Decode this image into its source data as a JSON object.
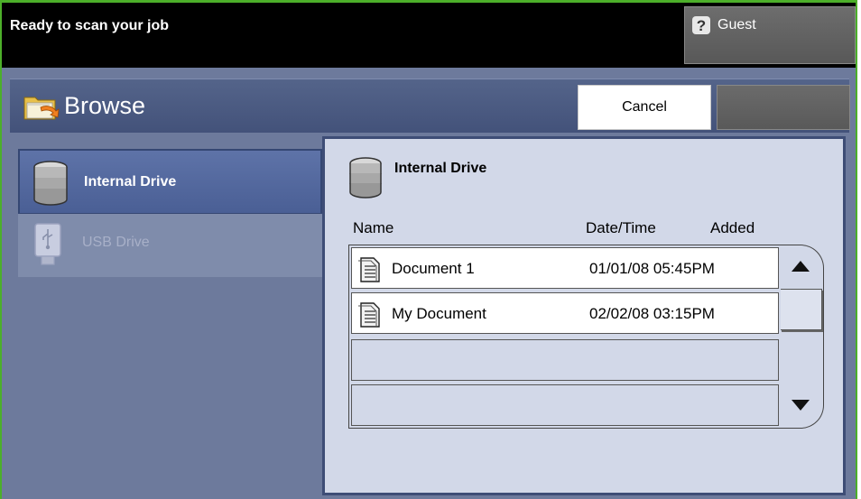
{
  "status": {
    "text": "Ready to scan your job"
  },
  "user": {
    "label": "Guest",
    "icon": "help-icon"
  },
  "header": {
    "title": "Browse",
    "icon": "folder-icon",
    "cancel_label": "Cancel"
  },
  "sidebar": {
    "items": [
      {
        "label": "Internal Drive",
        "icon": "database-icon",
        "selected": true,
        "enabled": true
      },
      {
        "label": "USB Drive",
        "icon": "usb-icon",
        "selected": false,
        "enabled": false
      }
    ]
  },
  "main": {
    "drive_title": "Internal Drive",
    "columns": {
      "name": "Name",
      "date": "Date/Time",
      "added": "Added"
    },
    "rows": [
      {
        "name": "Document 1",
        "date": "01/01/08 05:45PM"
      },
      {
        "name": "My Document",
        "date": "02/02/08 03:15PM"
      }
    ]
  },
  "colors": {
    "accent_border": "#4caf2a",
    "panel_bg": "#6d7a9c",
    "selected_item": "#4a5f95",
    "list_bg": "#d2d8e8"
  }
}
